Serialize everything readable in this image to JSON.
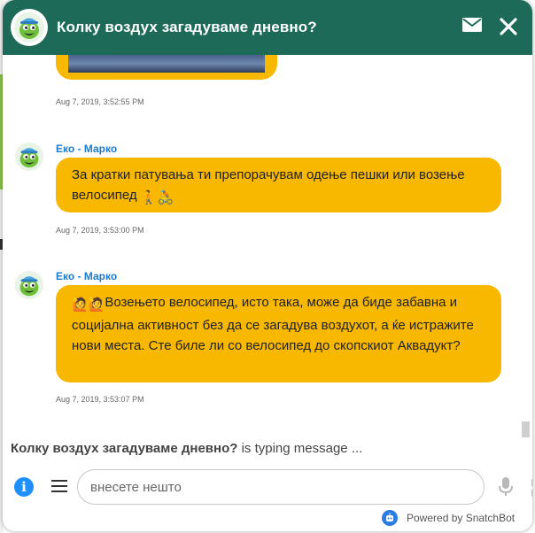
{
  "header": {
    "title": "Колку воздух загадуваме дневно?"
  },
  "messages": [
    {
      "kind": "image",
      "timestamp": "Aug 7, 2019, 3:52:55 PM"
    },
    {
      "kind": "text",
      "sender": "Еко - Марко",
      "text": "За кратки патувања ти препорачувам одење пешки или возење велосипед",
      "emoji_tail": "🚶🚴",
      "timestamp": "Aug 7, 2019, 3:53:00 PM"
    },
    {
      "kind": "text",
      "sender": "Еко - Марко",
      "emoji_head": "🙋🙋",
      "text": "Возењето велосипед, исто така, може да биде забавна и социјална активност без да се загадува воздухот, а ќе истражите нови места. Сте биле ли со велосипед до скопскиот Аквадукт?",
      "timestamp": "Aug 7, 2019, 3:53:07 PM"
    }
  ],
  "typing": {
    "name": "Колку воздух загадуваме дневно?",
    "suffix": " is typing message ..."
  },
  "composer": {
    "placeholder": "внесете нешто",
    "info_label": "i"
  },
  "footer": {
    "powered_by": "Powered by SnatchBot"
  },
  "colors": {
    "header_bg": "#1d6a59",
    "bubble_bg": "#f8b800",
    "sender_name": "#1f7ac8",
    "info_button": "#1e90ff"
  },
  "icons": [
    "bot-avatar-icon",
    "mail-icon",
    "close-icon",
    "info-icon",
    "menu-icon",
    "send-icon",
    "microphone-icon",
    "snatchbot-logo-icon"
  ]
}
